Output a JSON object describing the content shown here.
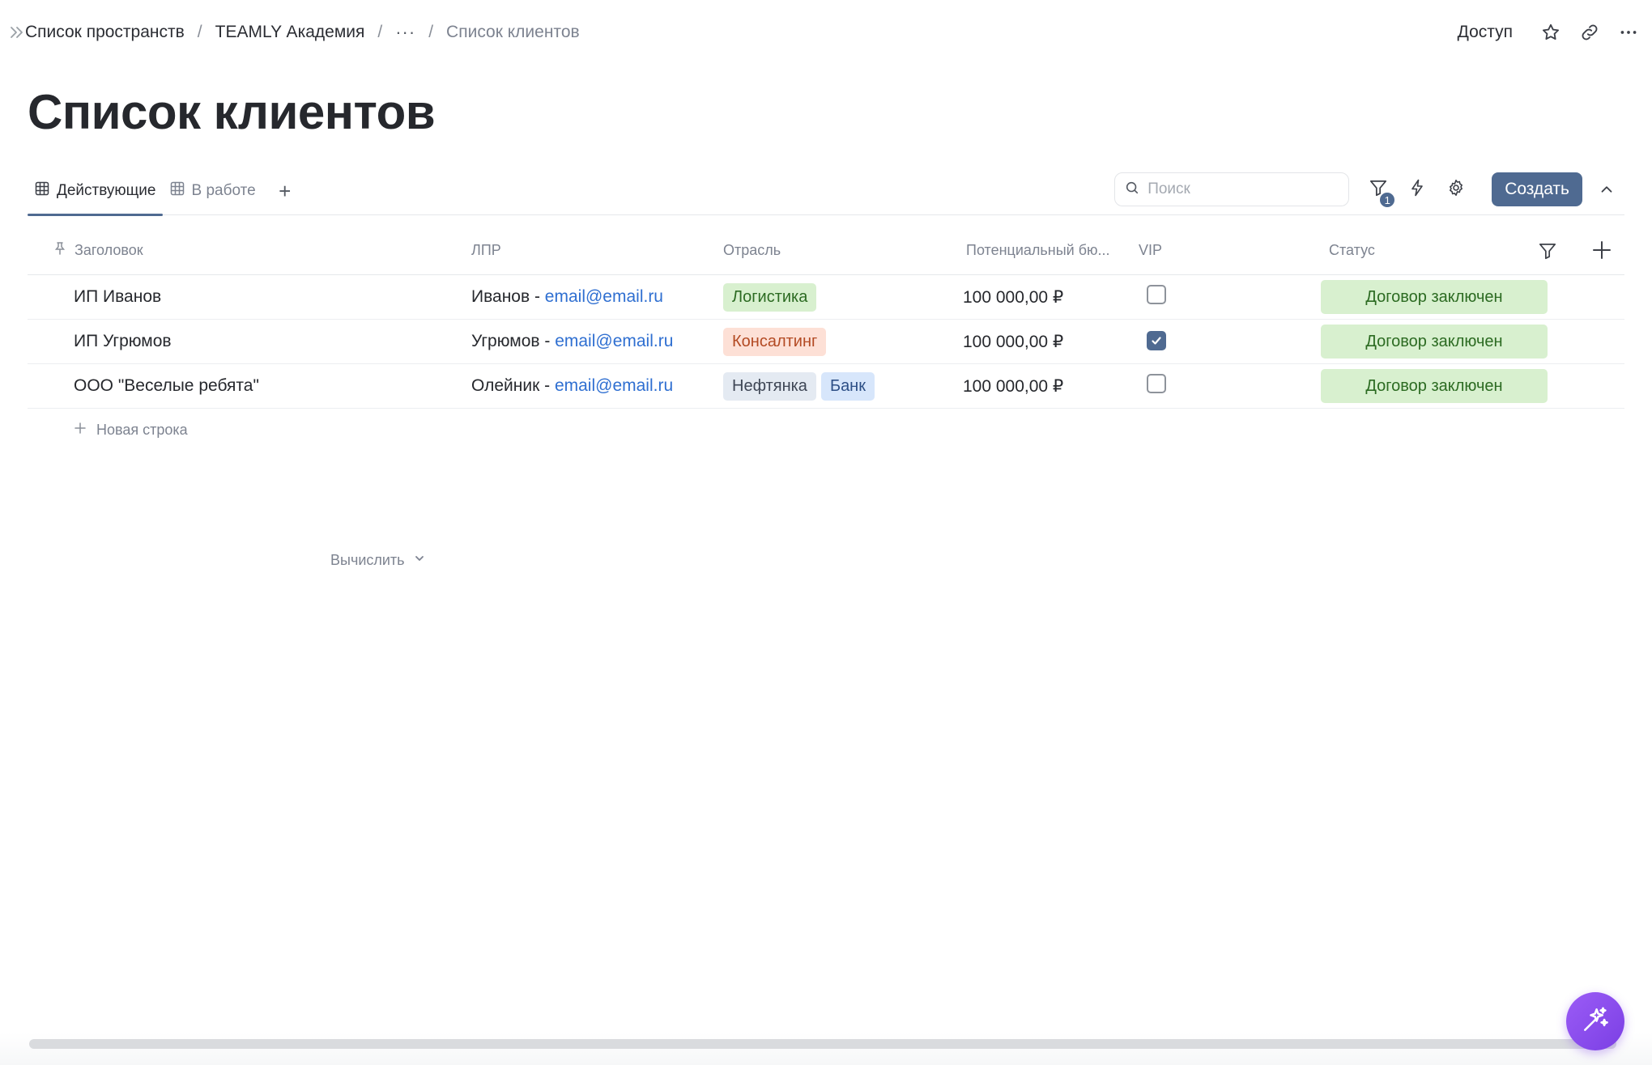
{
  "breadcrumb": {
    "items": [
      "Список пространств",
      "TEAMLY Академия",
      "···",
      "Список клиентов"
    ],
    "separator": "/"
  },
  "top_actions": {
    "access_label": "Доступ"
  },
  "page": {
    "title": "Список клиентов"
  },
  "tabs": [
    {
      "label": "Действующие",
      "active": true
    },
    {
      "label": "В работе",
      "active": false
    }
  ],
  "tab_add_label": "+",
  "toolbar": {
    "search_placeholder": "Поиск",
    "filter_count": "1",
    "create_label": "Создать"
  },
  "table": {
    "columns": [
      "Заголовок",
      "ЛПР",
      "Отрасль",
      "Потенциальный бю...",
      "VIP",
      "Статус"
    ],
    "rows": [
      {
        "title": "ИП Иванов",
        "lpr_name": "Иванов - ",
        "lpr_email": "email@email.ru",
        "tags": [
          "Логистика"
        ],
        "budget": "100 000,00 ₽",
        "vip": false,
        "status": "Договор заключен"
      },
      {
        "title": "ИП Угрюмов",
        "lpr_name": "Угрюмов - ",
        "lpr_email": "email@email.ru",
        "tags": [
          "Консалтинг"
        ],
        "budget": "100 000,00 ₽",
        "vip": true,
        "status": "Договор заключен"
      },
      {
        "title": "ООО \"Веселые ребята\"",
        "lpr_name": "Олейник - ",
        "lpr_email": "email@email.ru",
        "tags": [
          "Нефтянка",
          "Банк"
        ],
        "budget": "100 000,00 ₽",
        "vip": false,
        "status": "Договор заключен"
      }
    ],
    "new_row_label": "Новая строка",
    "calc_label": "Вычислить"
  },
  "colors": {
    "accent": "#4f6a91",
    "link": "#2f6fd1",
    "tag_green_bg": "#d8f0cf",
    "tag_orange_bg": "#fde0d6",
    "tag_gray_bg": "#e4eaf2",
    "tag_blue_bg": "#d7e6fb",
    "fab": "#8b4cf0"
  },
  "icons": {
    "expand": "chevrons-right-icon",
    "star": "star-icon",
    "link": "link-icon",
    "more": "more-horizontal-icon",
    "table_view": "table-grid-icon",
    "search": "search-icon",
    "filter": "filter-icon",
    "automation": "lightning-icon",
    "settings": "gear-icon",
    "collapse": "chevron-up-icon",
    "pin": "pin-icon",
    "add": "plus-icon",
    "ai": "sparkles-icon"
  }
}
